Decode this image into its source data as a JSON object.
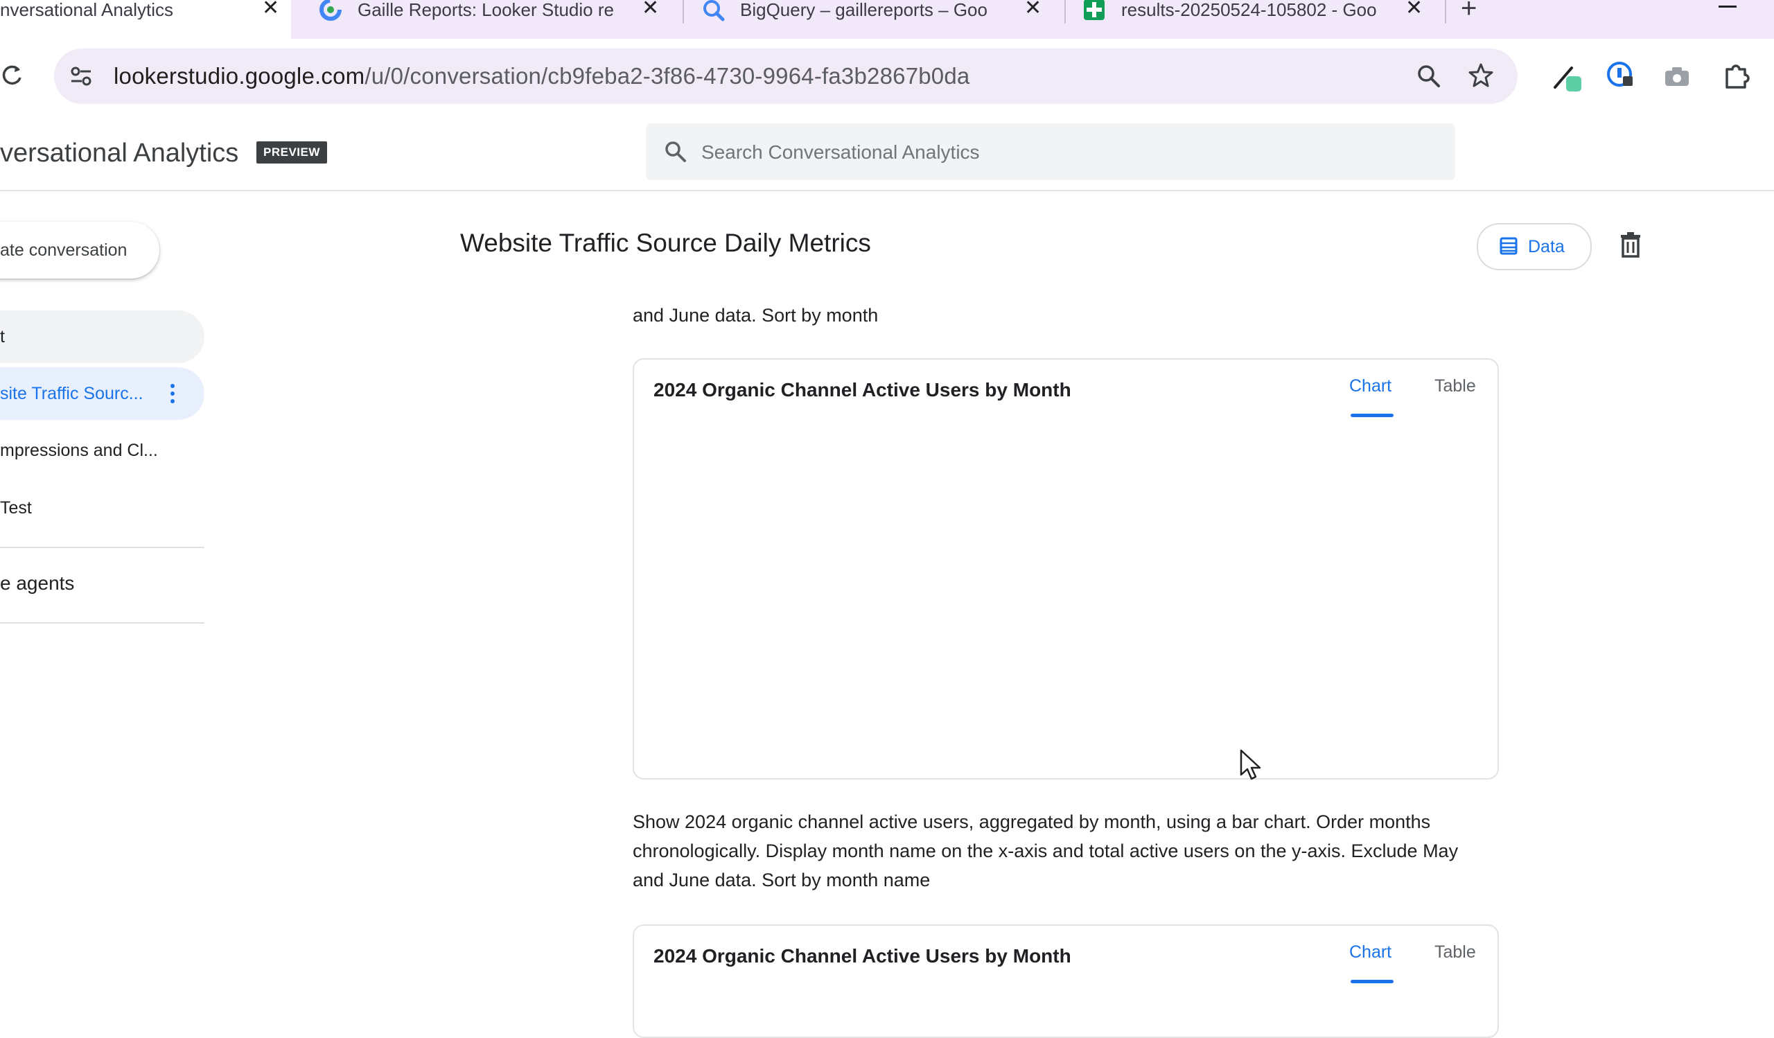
{
  "browser": {
    "tabs": [
      {
        "title": "nversational Analytics",
        "active": true
      },
      {
        "title": "Gaille Reports: Looker Studio re",
        "active": false
      },
      {
        "title": "BigQuery – gaillereports – Goo",
        "active": false
      },
      {
        "title": "results-20250524-105802 - Goo",
        "active": false
      }
    ],
    "url_host": "lookerstudio.google.com",
    "url_path": "/u/0/conversation/cb9feba2-3f86-4730-9964-fa3b2867b0da"
  },
  "app": {
    "title": "versational Analytics",
    "badge": "PREVIEW",
    "search_placeholder": "Search Conversational Analytics"
  },
  "sidebar": {
    "create_label": "ate conversation",
    "items": [
      {
        "label": "t",
        "state": "grey"
      },
      {
        "label": "site Traffic Sourc...",
        "state": "selected"
      },
      {
        "label": "mpressions and Cl...",
        "state": "normal"
      },
      {
        "label": " Test",
        "state": "normal"
      }
    ],
    "agents_label": "e agents"
  },
  "main": {
    "title": "Website Traffic Source Daily Metrics",
    "data_button": "Data",
    "prompt_1_tail": "and June data. Sort by month",
    "card_1": {
      "title": "2024 Organic Channel Active Users by Month",
      "tab_chart": "Chart",
      "tab_table": "Table"
    },
    "prompt_2": "Show 2024 organic channel active users, aggregated by month, using a bar chart. Order months chronologically. Display month name on the x-axis and total active users on the y-axis. Exclude May and June data. Sort by month name",
    "card_2": {
      "title": "2024 Organic Channel Active Users by Month",
      "tab_chart": "Chart",
      "tab_table": "Table"
    }
  },
  "colors": {
    "accent": "#1a73e8",
    "tabstrip": "#f1e8fa",
    "omnibox": "#f1ebf7"
  }
}
